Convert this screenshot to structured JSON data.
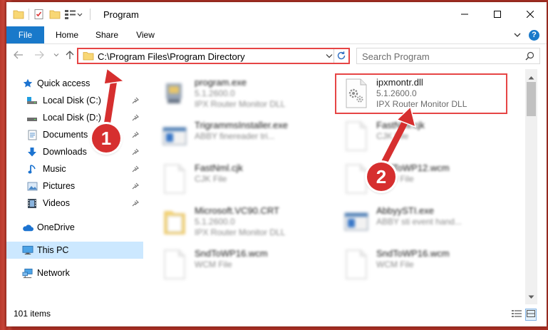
{
  "window": {
    "title": "Program"
  },
  "ribbon": {
    "tabs": [
      "File",
      "Home",
      "Share",
      "View"
    ],
    "help": "?"
  },
  "address": {
    "path": "C:\\Program Files\\Program Directory"
  },
  "search": {
    "placeholder": "Search Program"
  },
  "nav": {
    "items": [
      {
        "label": "Quick access",
        "icon": "star-icon"
      },
      {
        "label": "Local Disk (C:)",
        "icon": "drive-icon",
        "pinned": true
      },
      {
        "label": "Local Disk (D:)",
        "icon": "drive-icon",
        "pinned": true
      },
      {
        "label": "Documents",
        "icon": "documents-icon",
        "pinned": true
      },
      {
        "label": "Downloads",
        "icon": "download-arrow-icon",
        "pinned": true
      },
      {
        "label": "Music",
        "icon": "music-note-icon",
        "pinned": true
      },
      {
        "label": "Pictures",
        "icon": "pictures-icon",
        "pinned": true
      },
      {
        "label": "Videos",
        "icon": "film-icon",
        "pinned": true
      },
      {
        "label": "OneDrive",
        "icon": "cloud-icon"
      },
      {
        "label": "This PC",
        "icon": "monitor-icon",
        "selected": true
      },
      {
        "label": "Network",
        "icon": "network-icon"
      }
    ]
  },
  "files": [
    {
      "name": "program.exe",
      "line2": "5.1.2600.0",
      "line3": "IPX Router Monitor DLL",
      "icon": "exe-icon"
    },
    {
      "name": "ipxmontr.dll",
      "line2": "5.1.2600.0",
      "line3": "IPX Router Monitor DLL",
      "icon": "dll-gear-icon"
    },
    {
      "name": "TrigrammsInstaller.exe",
      "line2": "ABBY finereader tri...",
      "line3": "",
      "icon": "window-app-icon"
    },
    {
      "name": "FastNml.cjk",
      "line2": "CJK File",
      "line3": "",
      "icon": "blank-file-icon"
    },
    {
      "name": "FastNml.cjk",
      "line2": "CJK File",
      "line3": "",
      "icon": "blank-file-icon"
    },
    {
      "name": "SndToWP12.wcm",
      "line2": "WCM File",
      "line3": "",
      "icon": "blank-file-icon"
    },
    {
      "name": "Microsoft.VC90.CRT",
      "line2": "5.1.2600.0",
      "line3": "IPX Router Monitor DLL",
      "icon": "folder-icon"
    },
    {
      "name": "AbbyySTI.exe",
      "line2": "ABBY sti event hand...",
      "line3": "",
      "icon": "window-app-icon"
    },
    {
      "name": "SndToWP16.wcm",
      "line2": "WCM File",
      "line3": "",
      "icon": "blank-file-icon"
    },
    {
      "name": "SndToWP16.wcm",
      "line2": "WCM File",
      "line3": "",
      "icon": "blank-file-icon"
    }
  ],
  "status": {
    "count": "101 items"
  },
  "annotations": {
    "step1": "1",
    "step2": "2",
    "color": "#d62f2f"
  },
  "colors": {
    "accent": "#1979ca",
    "highlight": "#e64545",
    "selected": "#cce8ff"
  }
}
